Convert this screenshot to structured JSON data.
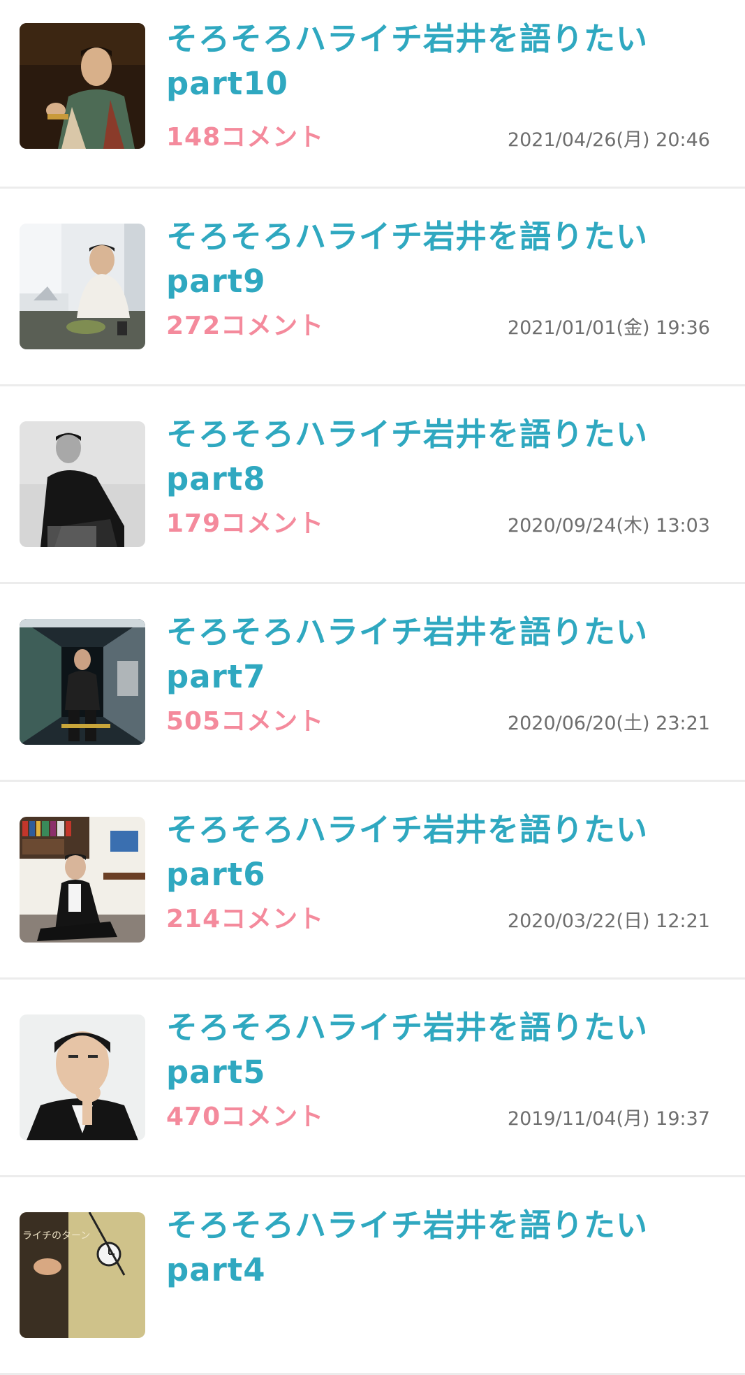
{
  "threads": [
    {
      "title": "そろそろハライチ岩井を語りたい",
      "part": "part10",
      "comments": "148コメント",
      "date": "2021/04/26(月) 20:46",
      "thumb_icon": "man-seated-photo"
    },
    {
      "title": "そろそろハライチ岩井を語りたい",
      "part": "part9",
      "comments": "272コメント",
      "date": "2021/01/01(金) 19:36",
      "thumb_icon": "man-eating-photo"
    },
    {
      "title": "そろそろハライチ岩井を語りたい",
      "part": "part8",
      "comments": "179コメント",
      "date": "2020/09/24(木) 13:03",
      "thumb_icon": "man-black-outfit-photo"
    },
    {
      "title": "そろそろハライチ岩井を語りたい",
      "part": "part7",
      "comments": "505コメント",
      "date": "2020/06/20(土) 23:21",
      "thumb_icon": "man-hallway-photo"
    },
    {
      "title": "そろそろハライチ岩井を語りたい",
      "part": "part6",
      "comments": "214コメント",
      "date": "2020/03/22(日) 12:21",
      "thumb_icon": "man-bookshelf-photo"
    },
    {
      "title": "そろそろハライチ岩井を語りたい",
      "part": "part5",
      "comments": "470コメント",
      "date": "2019/11/04(月) 19:37",
      "thumb_icon": "man-portrait-photo"
    },
    {
      "title": "そろそろハライチ岩井を語りたい",
      "part": "part4",
      "comments": "",
      "date": "",
      "thumb_icon": "man-studio-photo",
      "thumb_caption": "ライチのターン"
    }
  ]
}
